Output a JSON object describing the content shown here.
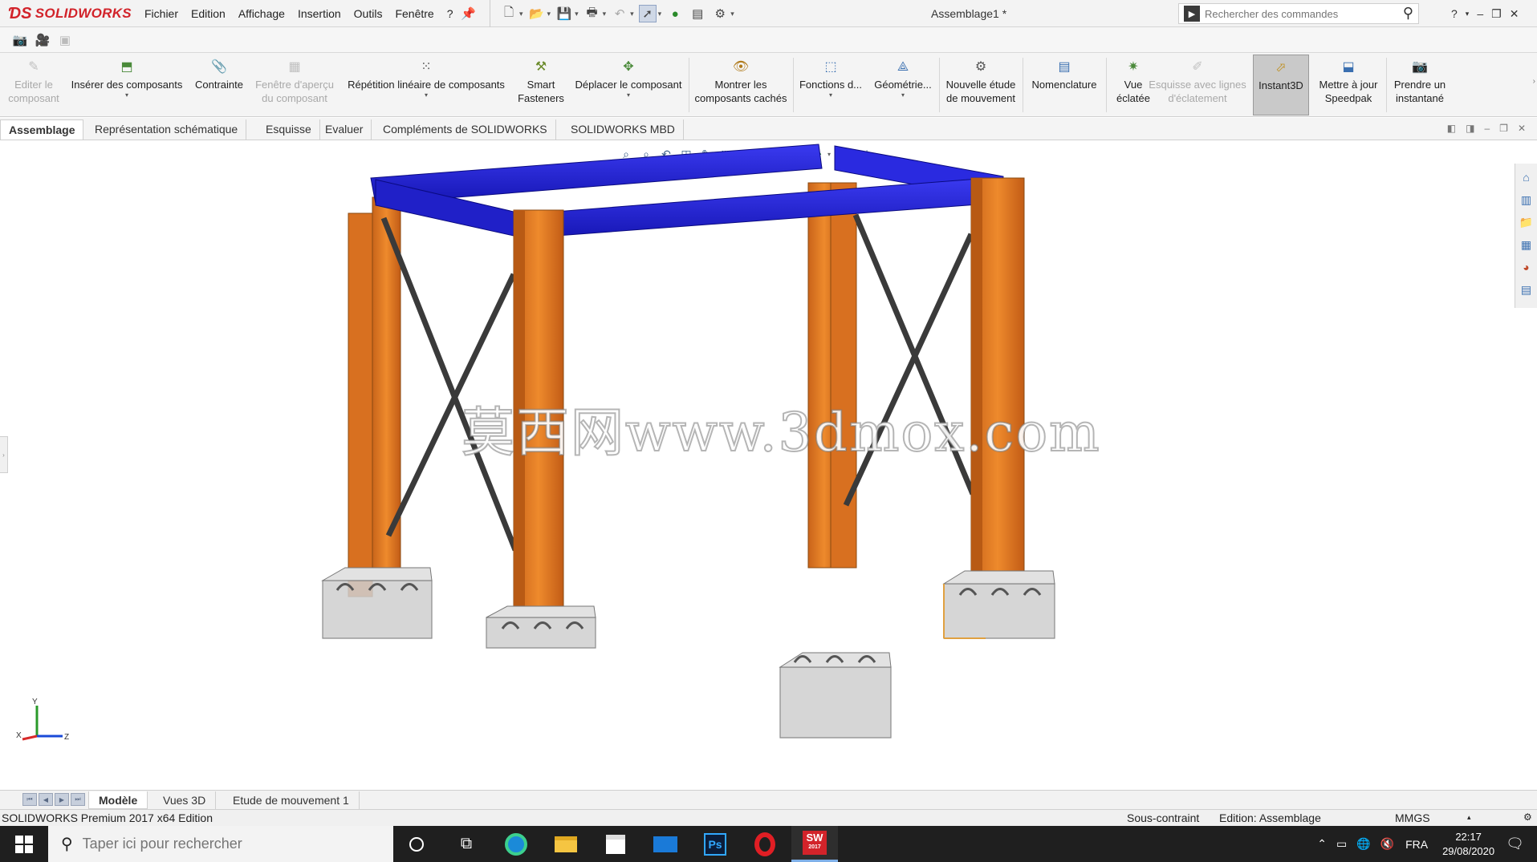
{
  "app": {
    "logo_text": "SOLIDWORKS",
    "document_title": "Assemblage1 *"
  },
  "menu": [
    "Fichier",
    "Edition",
    "Affichage",
    "Insertion",
    "Outils",
    "Fenêtre",
    "?"
  ],
  "search": {
    "placeholder": "Rechercher des commandes"
  },
  "window_controls": {
    "help": "?"
  },
  "ribbon": {
    "commands": [
      {
        "label": "Editer le composant",
        "disabled": true
      },
      {
        "label": "Insérer des composants",
        "disabled": false
      },
      {
        "label": "Contrainte",
        "disabled": false
      },
      {
        "label": "Fenêtre d'aperçu du composant",
        "disabled": true
      },
      {
        "label": "Répétition linéaire de composants",
        "disabled": false
      },
      {
        "label": "Smart Fasteners",
        "disabled": false
      },
      {
        "label": "Déplacer le composant",
        "disabled": false
      },
      {
        "label": "Montrer les composants cachés",
        "disabled": false
      },
      {
        "label": "Fonctions d...",
        "disabled": false
      },
      {
        "label": "Géométrie...",
        "disabled": false
      },
      {
        "label": "Nouvelle étude de mouvement",
        "disabled": false
      },
      {
        "label": "Nomenclature",
        "disabled": false
      },
      {
        "label": "Vue éclatée",
        "disabled": false
      },
      {
        "label": "Esquisse avec lignes d'éclatement",
        "disabled": true
      },
      {
        "label": "Instant3D",
        "disabled": false,
        "active": true
      },
      {
        "label": "Mettre à jour Speedpak",
        "disabled": false
      },
      {
        "label": "Prendre un instantané",
        "disabled": false
      }
    ]
  },
  "tabs": [
    "Assemblage",
    "Représentation schématique",
    "Esquisse",
    "Evaluer",
    "Compléments de SOLIDWORKS",
    "SOLIDWORKS MBD"
  ],
  "viewport": {
    "watermark": "莫西网www.3dmox.com",
    "triad_labels": {
      "x": "X",
      "y": "Y",
      "z": "Z"
    },
    "colors": {
      "beam": "#2a2ad8",
      "column": "#e07a1e",
      "footing": "#c8c8c8",
      "brace": "#3a3a3a"
    }
  },
  "bottom_tabs": [
    "Modèle",
    "Vues 3D",
    "Etude de mouvement 1"
  ],
  "status": {
    "edition": "SOLIDWORKS Premium 2017 x64 Edition",
    "constraint": "Sous-contraint",
    "editing": "Edition: Assemblage",
    "units": "MMGS"
  },
  "taskbar": {
    "search_placeholder": "Taper ici pour rechercher",
    "language": "FRA",
    "time": "22:17",
    "date": "29/08/2020",
    "solidworks_badge": "2017"
  }
}
